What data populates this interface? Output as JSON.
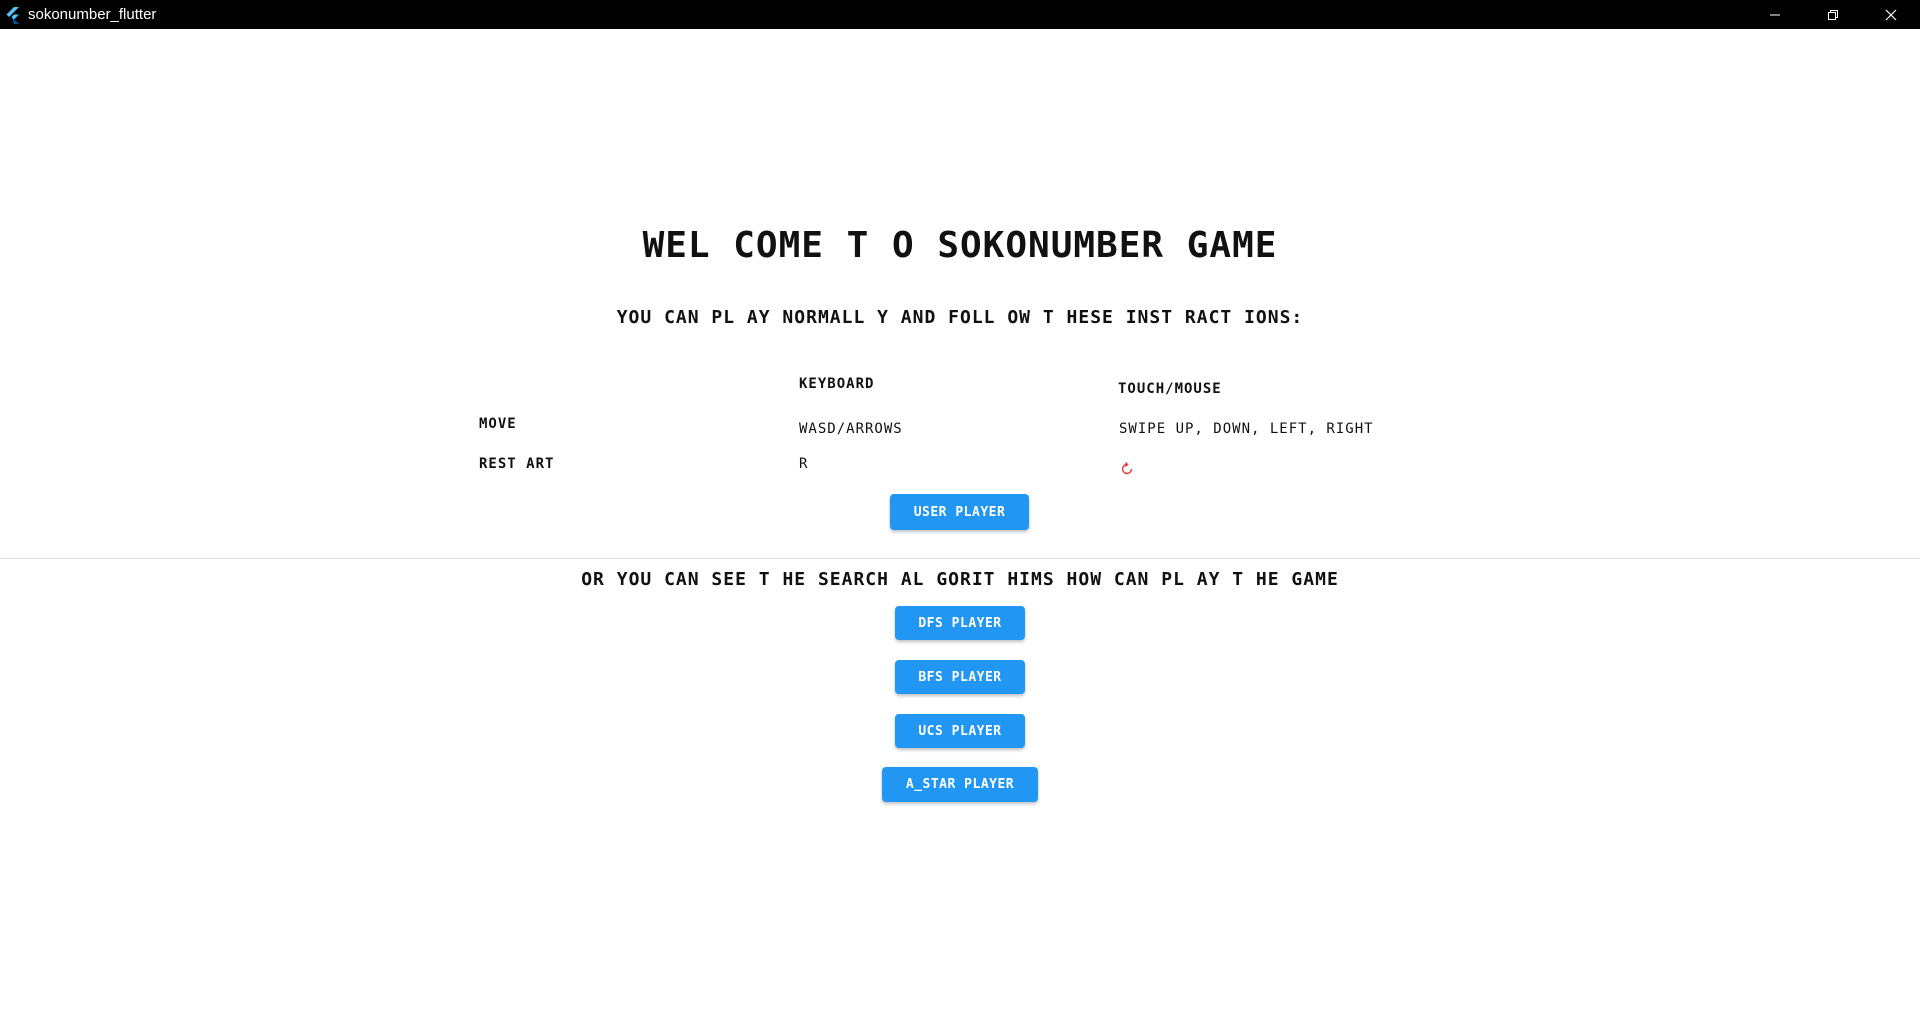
{
  "window": {
    "title": "sokonumber_flutter",
    "icons": [
      "flutter-logo-icon",
      "minimize-icon",
      "restore-icon",
      "close-icon"
    ]
  },
  "main": {
    "heading": "WEL COME T O SOKONUMBER GAME",
    "instructions_intro": "YOU CAN PL AY NORMALL Y AND FOLL OW T HESE INST RACT IONS:",
    "table": {
      "header_keyboard": "KEYBOARD",
      "header_touch": "TOUCH/MOUSE",
      "rows": [
        {
          "action": "MOVE",
          "keyboard": "WASD/ARROWS",
          "touch": "SWIPE UP, DOWN, LEFT, RIGHT"
        },
        {
          "action": "REST ART",
          "keyboard": "R",
          "touch_icon": "restart-icon"
        }
      ]
    },
    "user_player_button": "USER PLAYER",
    "algorithms_intro": "OR YOU CAN SEE T HE SEARCH AL GORIT HIMS HOW CAN PL AY T HE GAME",
    "algorithm_buttons": [
      "DFS PLAYER",
      "BFS PLAYER",
      "UCS PLAYER",
      "A_STAR PLAYER"
    ]
  },
  "colors": {
    "button_bg": "#2196f3",
    "button_text": "#ffffff",
    "titlebar_bg": "#000000",
    "restart_icon": "#e53935",
    "text": "#111111"
  }
}
